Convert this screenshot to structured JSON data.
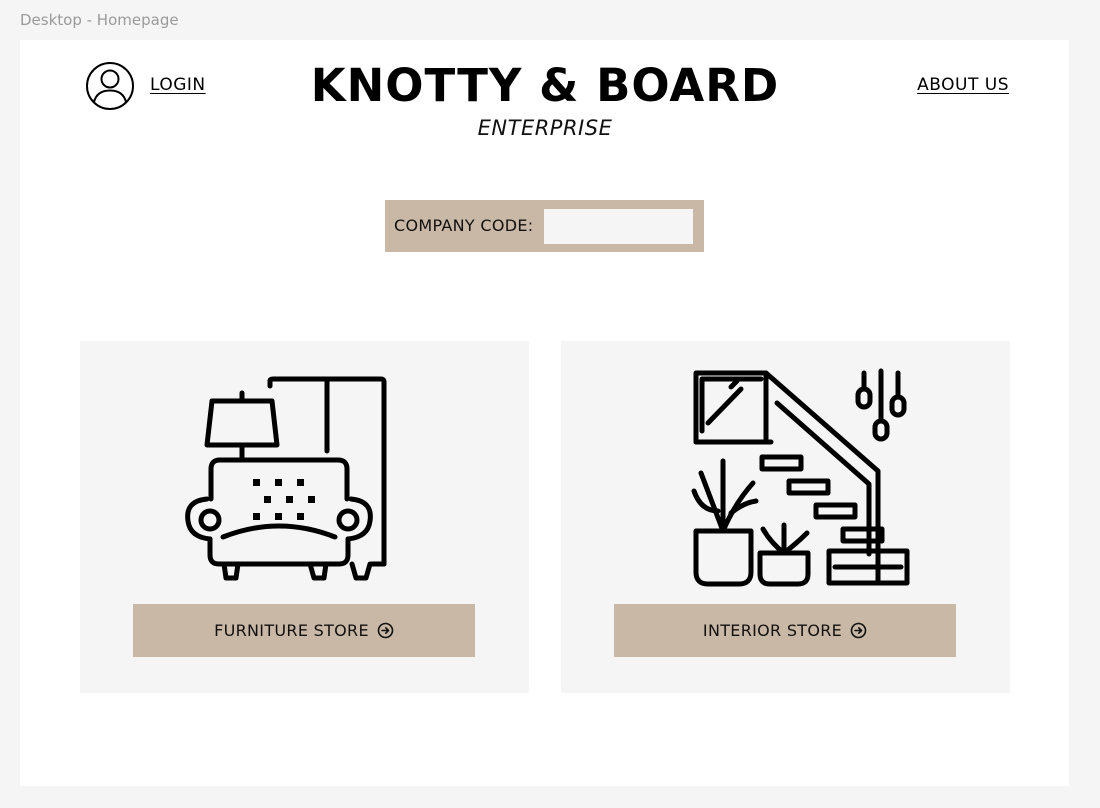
{
  "frame": {
    "label": "Desktop - Homepage"
  },
  "header": {
    "login_label": "LOGIN",
    "brand_title": "KNOTTY & BOARD",
    "brand_subtitle": "ENTERPRISE",
    "about_label": "ABOUT US",
    "user_icon": "user-circle-icon"
  },
  "company_code": {
    "label": "COMPANY CODE:",
    "value": "",
    "placeholder": ""
  },
  "cards": [
    {
      "button_label": "FURNITURE STORE",
      "illustration": "armchair-lamp-wardrobe-icon",
      "button_icon": "arrow-circle-right-icon"
    },
    {
      "button_label": "INTERIOR STORE",
      "illustration": "staircase-plants-icon",
      "button_icon": "arrow-circle-right-icon"
    }
  ],
  "colors": {
    "accent": "#c9b8a5",
    "card_background": "#f5f5f5",
    "text": "#000000"
  }
}
